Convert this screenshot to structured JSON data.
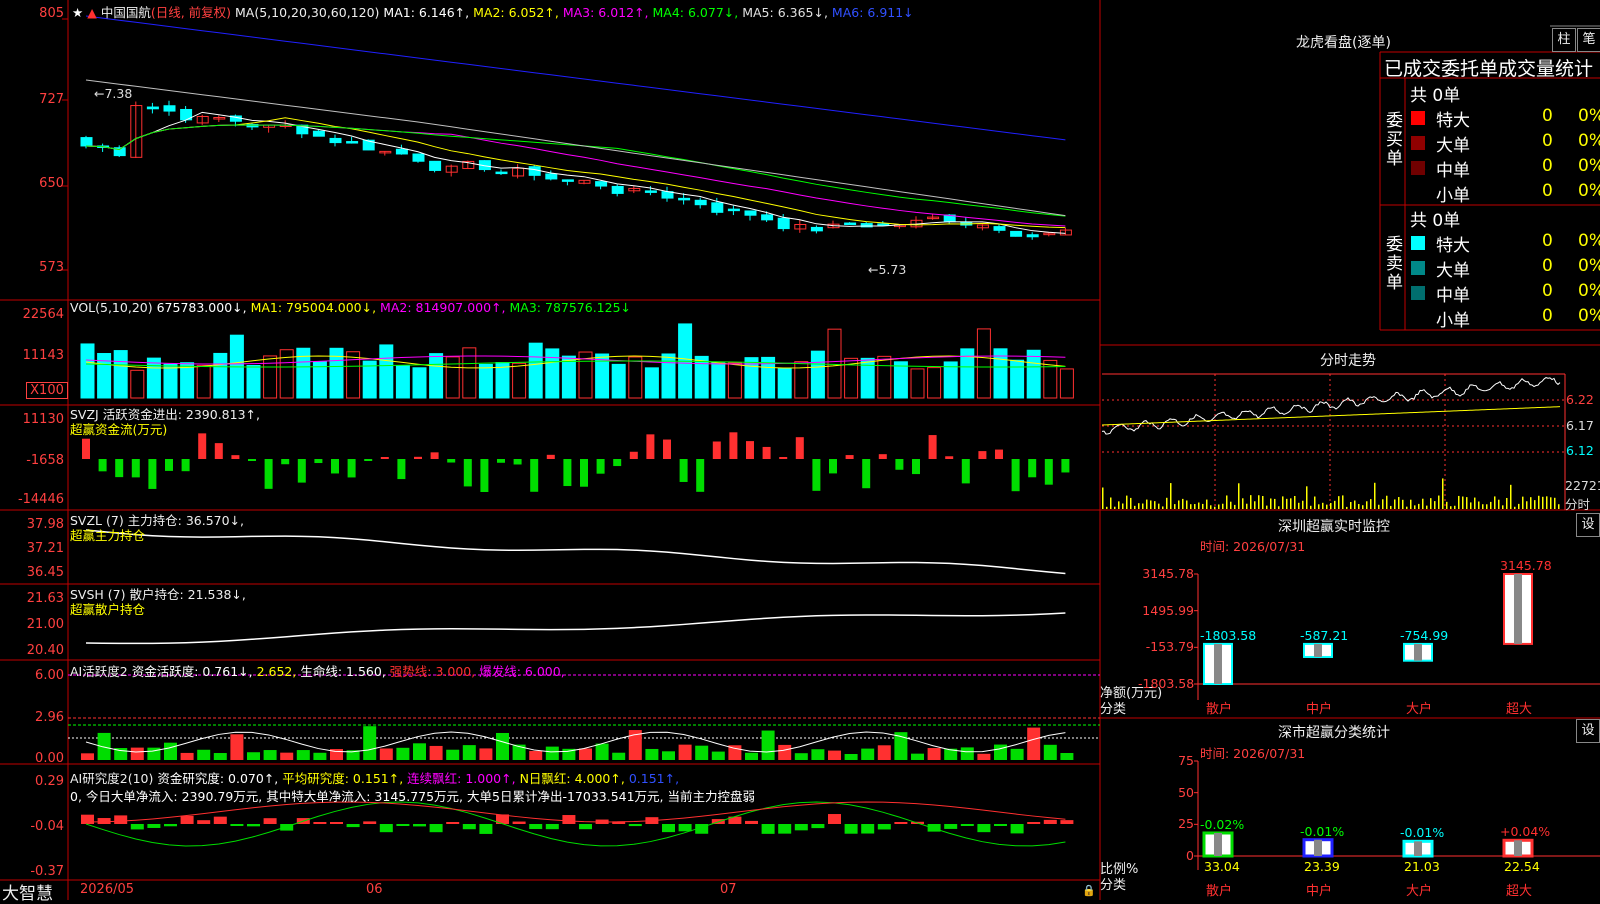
{
  "colors": {
    "up": "#ff3030",
    "down": "#00ffff",
    "grid": "#c00000",
    "ma1": "#ffffff",
    "ma2": "#ffff00",
    "ma3": "#ff00ff",
    "ma4": "#00ff00",
    "ma5": "#c0c0c0",
    "ma6": "#2020ff"
  },
  "main": {
    "star": "★",
    "title": "中国国航",
    "mode": "(日线, 前复权)",
    "ma_def": "MA(5,10,20,30,60,120)",
    "ma1": "MA1: 6.146↑,",
    "ma2": "MA2: 6.052↑,",
    "ma3": "MA3: 6.012↑,",
    "ma4": "MA4: 6.077↓,",
    "ma5": "MA5: 6.365↓,",
    "ma6": "MA6: 6.911↓",
    "high_label": "←7.38",
    "low_label": "←5.73",
    "yticks": [
      "805",
      "727",
      "650",
      "573"
    ]
  },
  "vol": {
    "def": "VOL(5,10,20)",
    "value": "675783.000↓,",
    "ma1": "MA1: 795004.000↓,",
    "ma2": "MA2: 814907.000↑,",
    "ma3": "MA3: 787576.125↓",
    "yticks": [
      "22564",
      "11143"
    ],
    "unit": "X100"
  },
  "svzj": {
    "def": "SVZJ  活跃资金进出: 2390.813↑,",
    "sub": "超赢资金流(万元)",
    "yticks": [
      "11130",
      "-1658",
      "-14446"
    ]
  },
  "svzl": {
    "def": "SVZL (7) 主力持仓: 36.570↓,",
    "sub": "超赢主力持仓",
    "yticks": [
      "37.98",
      "37.21",
      "36.45"
    ]
  },
  "svsh": {
    "def": "SVSH (7) 散户持仓: 21.538↓,",
    "sub": "超赢散户持仓",
    "yticks": [
      "21.63",
      "21.00",
      "20.40"
    ]
  },
  "ai2": {
    "name": "AI活跃度2",
    "a": "资金活跃度: 0.761↓,",
    "b": "2.652,",
    "c": "生命线: 1.560,",
    "d": "强势线: 3.000,",
    "e": "爆发线: 6.000,",
    "yticks": [
      "6.00",
      "2.96",
      "0.00"
    ]
  },
  "ai3": {
    "name": "AI研究度2(10)",
    "a": "资金研究度: 0.070↑,",
    "b": "平均研究度: 0.151↑,",
    "c": "连续飘红: 1.000↑,",
    "d": "N日飘红: 4.000↑,",
    "e": "0.151↑,",
    "desc": "0, 今日大单净流入: 2390.79万元, 其中特大单净流入: 3145.775万元, 大单5日累计净出-17033.541万元, 当前主力控盘弱",
    "yticks": [
      "0.29",
      "-0.04",
      "-0.37"
    ]
  },
  "xaxis": {
    "brand": "大智慧",
    "labels": [
      "2026/05",
      "06",
      "07"
    ]
  },
  "lhb": {
    "title": "龙虎看盘(逐单)",
    "btn_bar": "柱",
    "btn_line": "笔",
    "header": "已成交委托单成交量统计",
    "buy_label": "委买单",
    "sell_label": "委卖单",
    "buy_total": "共 0单",
    "sell_total": "共 0单",
    "rows_buy": [
      {
        "name": "特大",
        "num": "0",
        "pct": "0%",
        "color": "#ff0000"
      },
      {
        "name": "大单",
        "num": "0",
        "pct": "0%",
        "color": "#900000"
      },
      {
        "name": "中单",
        "num": "0",
        "pct": "0%",
        "color": "#700000"
      },
      {
        "name": "小单",
        "num": "0",
        "pct": "0%",
        "color": ""
      }
    ],
    "rows_sell": [
      {
        "name": "特大",
        "num": "0",
        "pct": "0%",
        "color": "#00ffff"
      },
      {
        "name": "大单",
        "num": "0",
        "pct": "0%",
        "color": "#008888"
      },
      {
        "name": "中单",
        "num": "0",
        "pct": "0%",
        "color": "#006e6e"
      },
      {
        "name": "小单",
        "num": "0",
        "pct": "0%",
        "color": ""
      }
    ]
  },
  "fenshi": {
    "title": "分时走势",
    "yticks": [
      "6.22",
      "6.17",
      "6.12"
    ],
    "vol": "22721",
    "unit": "分时"
  },
  "monitor": {
    "title": "深圳超赢实时监控",
    "btn": "设",
    "time": "时间: 2026/07/31",
    "yticks": [
      "3145.78",
      "1495.99",
      "-153.79",
      "-1803.58"
    ],
    "ylabel": "净额(万元)",
    "xlabel": "分类",
    "cats": [
      "散户",
      "中户",
      "大户",
      "超大"
    ],
    "values": [
      -1803.58,
      -587.21,
      -754.99,
      3145.78
    ],
    "value_labels": [
      "-1803.58",
      "-587.21",
      "-754.99",
      "3145.78"
    ]
  },
  "stats": {
    "title": "深市超赢分类统计",
    "btn": "设",
    "time": "时间: 2026/07/31",
    "yticks": [
      "75",
      "50",
      "25",
      "0"
    ],
    "ylabel": "比例%",
    "xlabel": "分类",
    "cats": [
      "散户",
      "中户",
      "大户",
      "超大"
    ],
    "values": [
      33.04,
      23.39,
      21.03,
      22.54
    ],
    "value_labels": [
      "33.04",
      "23.39",
      "21.03",
      "22.54"
    ],
    "changes": [
      "-0.02%",
      "-0.01%",
      "-0.01%",
      "+0.04%"
    ]
  }
}
